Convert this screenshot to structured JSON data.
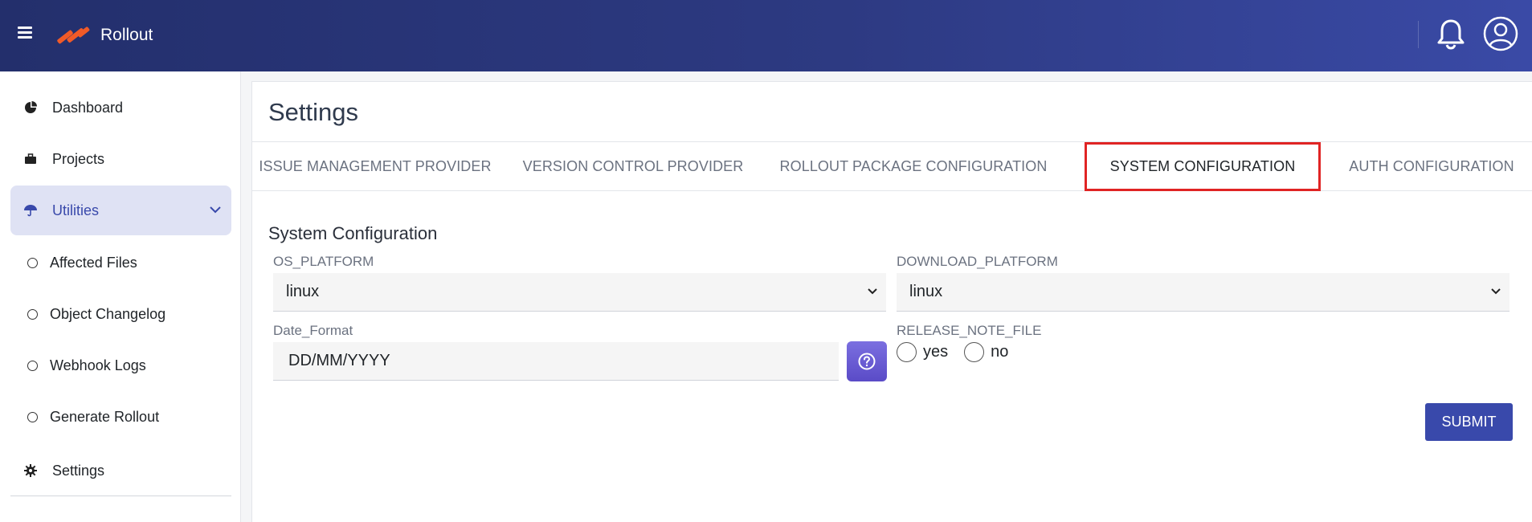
{
  "app": {
    "title": "Rollout"
  },
  "header": {
    "menu_icon": "hamburger-icon",
    "logo_icon": "rollout-logo",
    "bell_icon": "bell-icon",
    "avatar_icon": "user-avatar-icon"
  },
  "sidebar": {
    "items": [
      {
        "label": "Dashboard",
        "icon": "pie-chart-icon"
      },
      {
        "label": "Projects",
        "icon": "briefcase-icon"
      },
      {
        "label": "Utilities",
        "icon": "umbrella-icon",
        "expanded": true
      },
      {
        "label": "Affected Files",
        "icon": "circle-icon"
      },
      {
        "label": "Object Changelog",
        "icon": "circle-icon"
      },
      {
        "label": "Webhook Logs",
        "icon": "circle-icon"
      },
      {
        "label": "Generate Rollout",
        "icon": "circle-icon"
      },
      {
        "label": "Settings",
        "icon": "gear-icon"
      }
    ]
  },
  "main": {
    "title": "Settings",
    "tabs": [
      {
        "label": "ISSUE MANAGEMENT PROVIDER"
      },
      {
        "label": "VERSION CONTROL PROVIDER"
      },
      {
        "label": "ROLLOUT PACKAGE CONFIGURATION"
      },
      {
        "label": "SYSTEM CONFIGURATION",
        "selected": true
      },
      {
        "label": "AUTH CONFIGURATION"
      }
    ],
    "section_title": "System Configuration",
    "fields": {
      "os_platform": {
        "label": "OS_PLATFORM",
        "value": "linux"
      },
      "download_platform": {
        "label": "DOWNLOAD_PLATFORM",
        "value": "linux"
      },
      "date_format": {
        "label": "Date_Format",
        "value": "DD/MM/YYYY"
      },
      "release_note_file": {
        "label": "RELEASE_NOTE_FILE",
        "options": [
          "yes",
          "no"
        ],
        "selected": null
      }
    },
    "submit_label": "SUBMIT"
  },
  "colors": {
    "accent": "#3949ab",
    "header_start": "#232f6c",
    "header_end": "#3a4aa6",
    "tab_highlight": "#e02424",
    "help_button": "#6a5cd5"
  }
}
